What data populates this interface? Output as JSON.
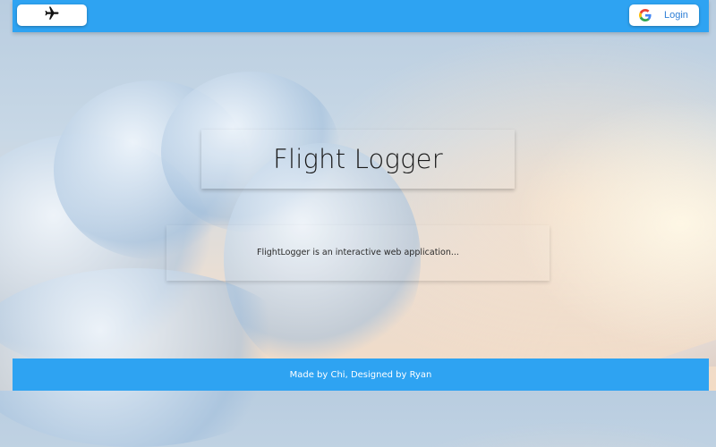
{
  "topbar": {
    "home_icon": "airplane-icon",
    "login": {
      "icon": "google-icon",
      "label": "Login"
    }
  },
  "main": {
    "title": "Flight Logger",
    "description": "FlightLogger is an interactive web application..."
  },
  "footer": {
    "credit": "Made by Chi, Designed by Ryan"
  },
  "colors": {
    "bar": "#2ea3f2",
    "login_text": "#2e7fd6"
  }
}
